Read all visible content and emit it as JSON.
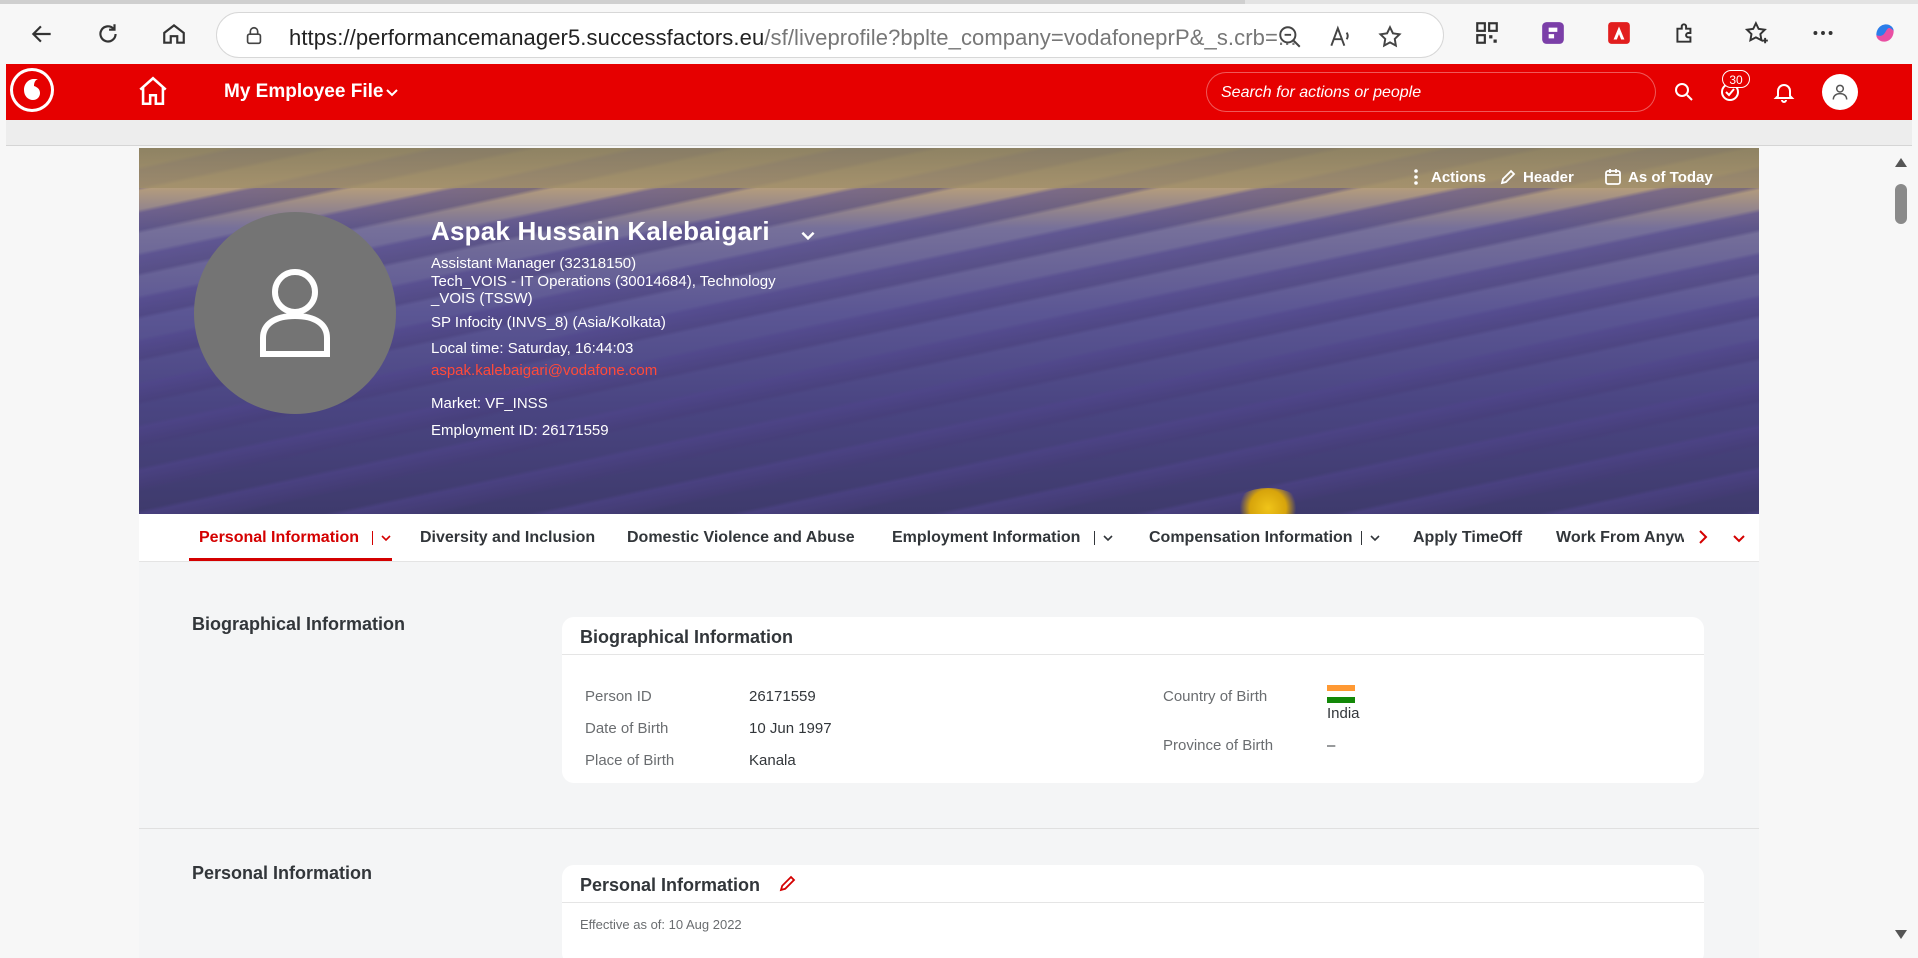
{
  "browser": {
    "url_host": "https://performancemanager5.successfactors.eu",
    "url_path": "/sf/liveprofile?bplte_company=vodafoneprP&_s.crb=..."
  },
  "header": {
    "title": "My Employee File",
    "search_placeholder": "Search for actions or people",
    "notification_count": "30"
  },
  "profile": {
    "name": "Aspak Hussain Kalebaigari",
    "position": "Assistant Manager (32318150)",
    "department_line1": "Tech_VOIS - IT Operations (30014684), Technology",
    "department_line2": "_VOIS (TSSW)",
    "location": "SP Infocity (INVS_8) (Asia/Kolkata)",
    "local_time": "Local time: Saturday, 16:44:03",
    "email": "aspak.kalebaigari@vodafone.com",
    "market": "Market: VF_INSS",
    "employment_id": "Employment ID: 26171559",
    "actions_label": "Actions",
    "header_label": "Header",
    "as_of_label": "As of Today"
  },
  "tabs": [
    {
      "label": "Personal Information"
    },
    {
      "label": "Diversity and Inclusion"
    },
    {
      "label": "Domestic Violence and Abuse"
    },
    {
      "label": "Employment Information"
    },
    {
      "label": "Compensation Information"
    },
    {
      "label": "Apply TimeOff"
    },
    {
      "label": "Work From Anyw"
    }
  ],
  "bio_section": {
    "section_title": "Biographical Information",
    "card_title": "Biographical Information",
    "fields": [
      {
        "label": "Person ID",
        "value": "26171559"
      },
      {
        "label": "Date of Birth",
        "value": "10 Jun 1997"
      },
      {
        "label": "Place of Birth",
        "value": "Kanala"
      },
      {
        "label": "Country of Birth",
        "value": "India"
      },
      {
        "label": "Province of Birth",
        "value": "–"
      }
    ]
  },
  "personal_section": {
    "section_title": "Personal Information",
    "card_title": "Personal Information",
    "effective": "Effective as of: 10 Aug 2022"
  },
  "colors": {
    "brand_red": "#e60000",
    "active_tab": "#d40000"
  }
}
